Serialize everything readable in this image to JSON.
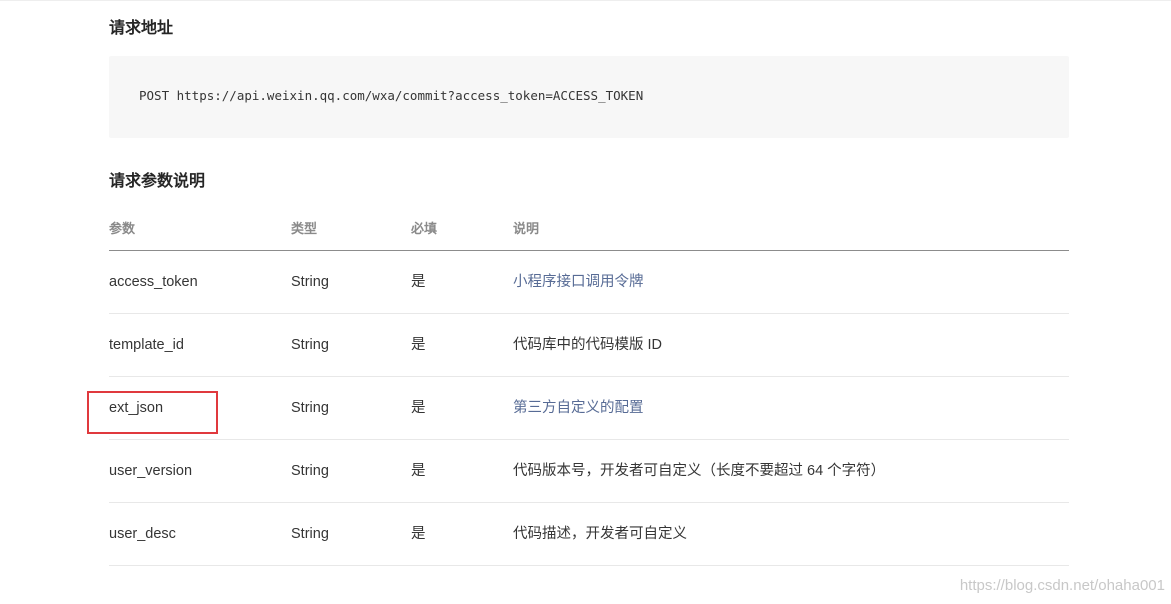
{
  "sections": {
    "request_address": {
      "title": "请求地址",
      "code": "POST https://api.weixin.qq.com/wxa/commit?access_token=ACCESS_TOKEN"
    },
    "request_params": {
      "title": "请求参数说明",
      "headers": [
        "参数",
        "类型",
        "必填",
        "说明"
      ],
      "rows": [
        {
          "name": "access_token",
          "type": "String",
          "required": "是",
          "desc": "小程序接口调用令牌",
          "desc_is_link": true
        },
        {
          "name": "template_id",
          "type": "String",
          "required": "是",
          "desc": "代码库中的代码模版 ID",
          "desc_is_link": false
        },
        {
          "name": "ext_json",
          "type": "String",
          "required": "是",
          "desc": "第三方自定义的配置",
          "desc_is_link": true
        },
        {
          "name": "user_version",
          "type": "String",
          "required": "是",
          "desc": "代码版本号，开发者可自定义（长度不要超过 64 个字符）",
          "desc_is_link": false
        },
        {
          "name": "user_desc",
          "type": "String",
          "required": "是",
          "desc": "代码描述，开发者可自定义",
          "desc_is_link": false
        }
      ]
    }
  },
  "highlight": {
    "color": "#e0393d",
    "target": "ext_json"
  },
  "watermark": "https://blog.csdn.net/ohaha001",
  "colors": {
    "link": "#576b95",
    "code_bg": "#f7f7f7",
    "text": "#353535"
  }
}
